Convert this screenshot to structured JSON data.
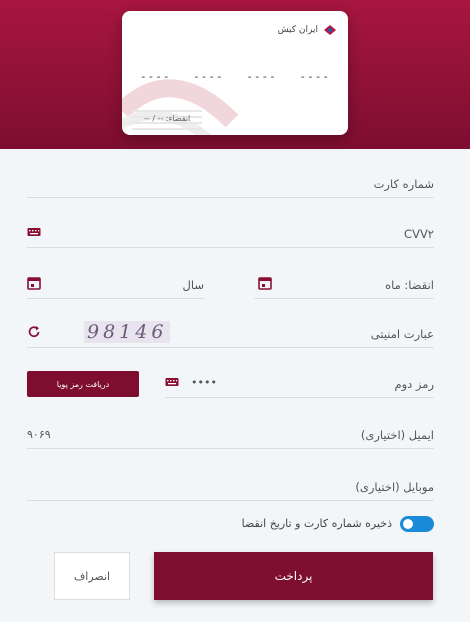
{
  "card": {
    "bank_name": "ایران کیش",
    "number_groups": [
      "----",
      "----",
      "----",
      "----"
    ],
    "expiry_label": "انقضاء: -- / --"
  },
  "form": {
    "card_number_label": "شماره کارت",
    "cvv2_label": "CVV۲",
    "expiry_month_label": "انقضا: ماه",
    "expiry_year_label": "سال",
    "captcha_label": "عبارت امنیتی",
    "captcha_value": "98146",
    "second_password_label": "رمز دوم",
    "second_password_value": "••••",
    "otp_button": "دریافت رمز پویا",
    "email_label": "ایمیل (اختیاری)",
    "email_value": "۹۰۶۹",
    "mobile_label": "موبایل (اختیاری)",
    "save_card_label": "ذخیره شماره کارت و تاریخ انقضا",
    "save_card_enabled": true
  },
  "actions": {
    "pay": "پرداخت",
    "cancel": "انصراف"
  },
  "colors": {
    "brand": "#7d0e30",
    "toggle": "#1a8bd8"
  }
}
